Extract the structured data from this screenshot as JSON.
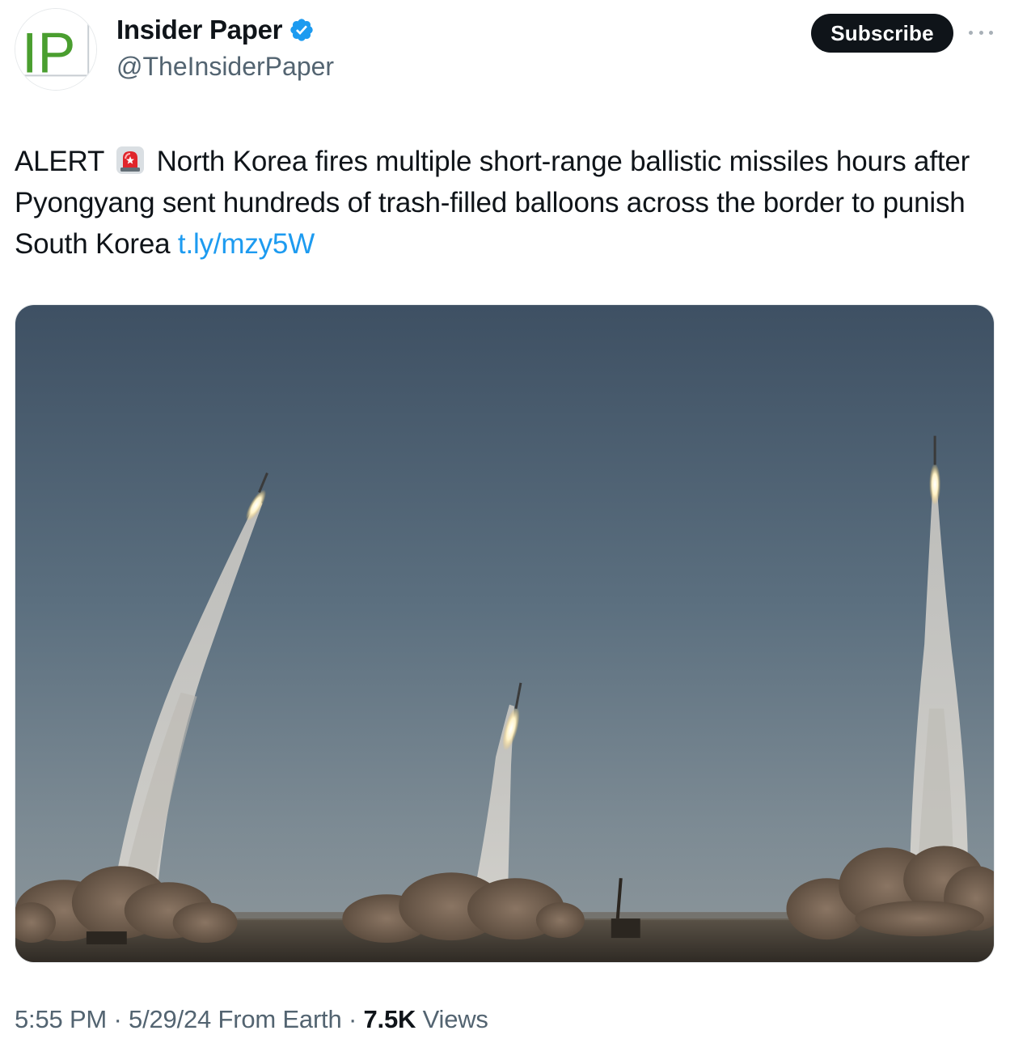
{
  "author": {
    "avatar_text": "IP",
    "name": "Insider Paper",
    "handle": "@TheInsiderPaper",
    "verified": true
  },
  "header": {
    "subscribe_label": "Subscribe",
    "more_icon": "more-horizontal-icon"
  },
  "tweet": {
    "text_prefix": "ALERT",
    "emoji_icon": "police-car-light-icon",
    "text_body": "North Korea fires multiple short-range ballistic missiles hours after Pyongyang sent hundreds of trash-filled balloons across the border to punish South Korea",
    "link_text": "t.ly/mzy5W"
  },
  "meta": {
    "time": "5:55 PM",
    "date": "5/29/24",
    "location": "From Earth",
    "views_count": "7.5K",
    "views_label": "Views"
  },
  "colors": {
    "link": "#1d9bf0",
    "verified_badge": "#1d9bf0",
    "subscribe_bg": "#0f1419",
    "secondary_text": "#536471",
    "avatar_green": "#4a9e2f"
  }
}
